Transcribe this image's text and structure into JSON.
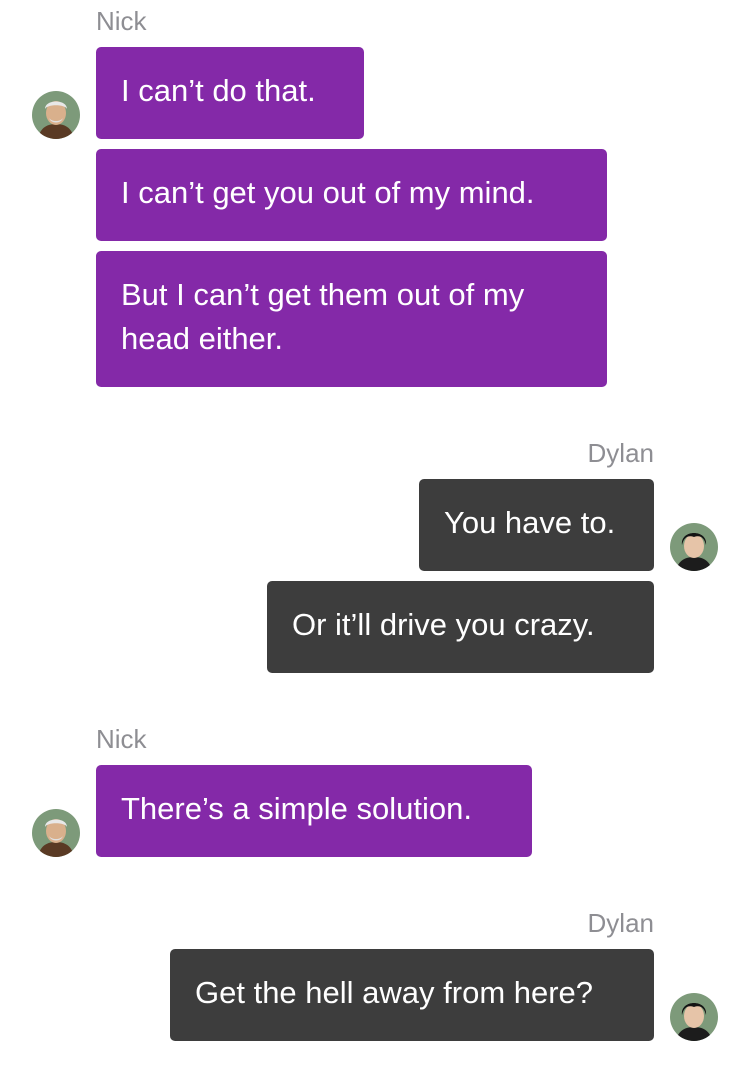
{
  "participants": {
    "nick": {
      "name": "Nick",
      "bubble_color": "#8429a8",
      "avatar_icon": "nick-avatar"
    },
    "dylan": {
      "name": "Dylan",
      "bubble_color": "#3d3d3d",
      "avatar_icon": "dylan-avatar"
    }
  },
  "messages": [
    {
      "sender": "Nick",
      "text": "I can’t do that."
    },
    {
      "sender": "Nick",
      "text": "I can’t get you out of my mind."
    },
    {
      "sender": "Nick",
      "text": "But I can’t get them out of my head either."
    },
    {
      "sender": "Dylan",
      "text": "You have to."
    },
    {
      "sender": "Dylan",
      "text": "Or it’ll drive you crazy."
    },
    {
      "sender": "Nick",
      "text": "There’s a simple solution."
    },
    {
      "sender": "Dylan",
      "text": "Get the hell away from here?"
    }
  ]
}
